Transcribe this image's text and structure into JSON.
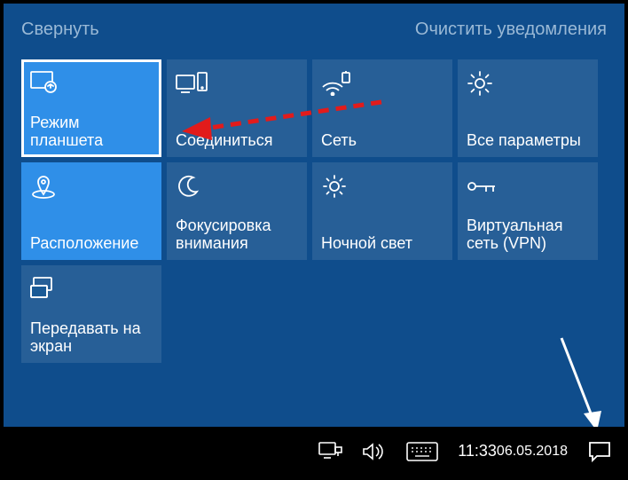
{
  "header": {
    "collapse": "Свернуть",
    "clear": "Очистить уведомления"
  },
  "tiles": [
    {
      "id": "tablet-mode",
      "label": "Режим планшета"
    },
    {
      "id": "connect",
      "label": "Соединиться"
    },
    {
      "id": "network",
      "label": "Сеть"
    },
    {
      "id": "all-settings",
      "label": "Все параметры"
    },
    {
      "id": "location",
      "label": "Расположение"
    },
    {
      "id": "focus-assist",
      "label": "Фокусировка внимания"
    },
    {
      "id": "night-light",
      "label": "Ночной свет"
    },
    {
      "id": "vpn",
      "label": "Виртуальная сеть (VPN)"
    },
    {
      "id": "project",
      "label": "Передавать на экран"
    }
  ],
  "clock": {
    "time": "11:33",
    "date": "06.05.2018"
  }
}
